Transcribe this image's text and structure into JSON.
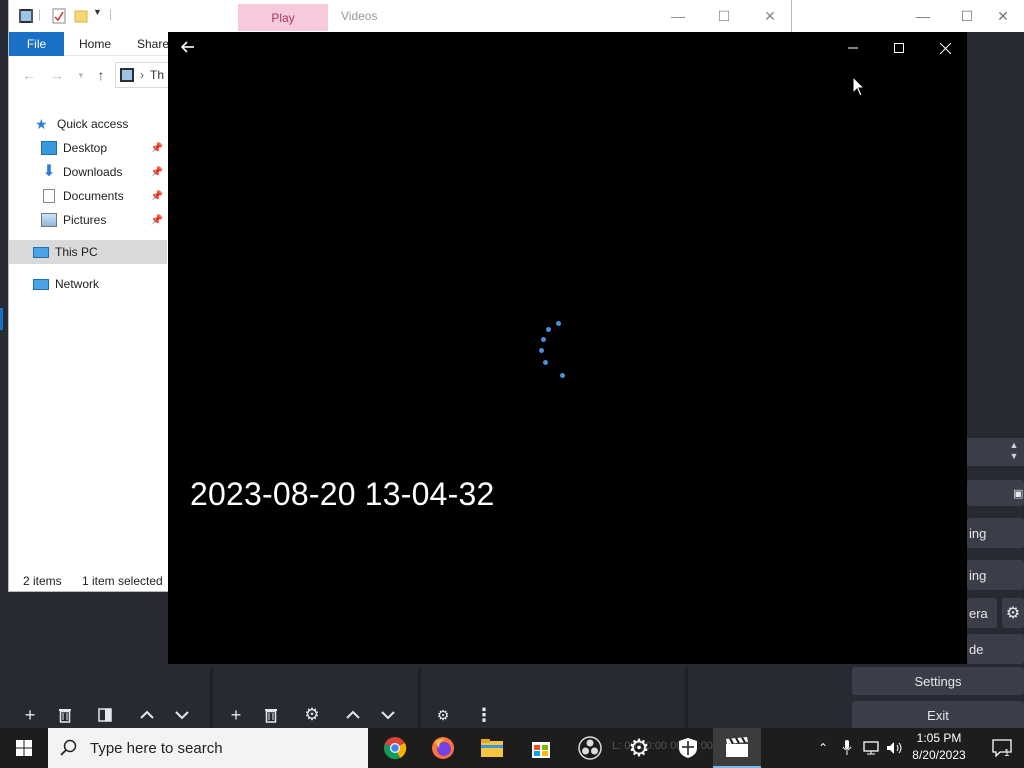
{
  "obs": {
    "buttons_full": [
      "Settings",
      "Exit"
    ],
    "buttons_partial": [
      "ing",
      "ing",
      "era",
      "de"
    ],
    "status_ghost": "L: 00:00:00   00:00:00"
  },
  "explorer": {
    "ribbon_tabs": [
      "File",
      "Home",
      "Share"
    ],
    "contextual_tab": "Play",
    "title": "Videos",
    "address_crumb": "Th",
    "nav": {
      "quick_access": "Quick access",
      "desktop": "Desktop",
      "downloads": "Downloads",
      "documents": "Documents",
      "pictures": "Pictures",
      "this_pc": "This PC",
      "network": "Network"
    },
    "status_items": "2 items",
    "status_selected": "1 item selected"
  },
  "player": {
    "video_title": "2023-08-20 13-04-32"
  },
  "taskbar": {
    "search_placeholder": "Type here to search",
    "time": "1:05 PM",
    "date": "8/20/2023",
    "notification_count": "1"
  },
  "colors": {
    "accent_blue": "#1a6fc7",
    "spinner_blue": "#4a90d9",
    "play_tab_bg": "#f7c9dc",
    "taskbar_bg": "#1d1d1d",
    "obs_bg": "#272a33"
  }
}
